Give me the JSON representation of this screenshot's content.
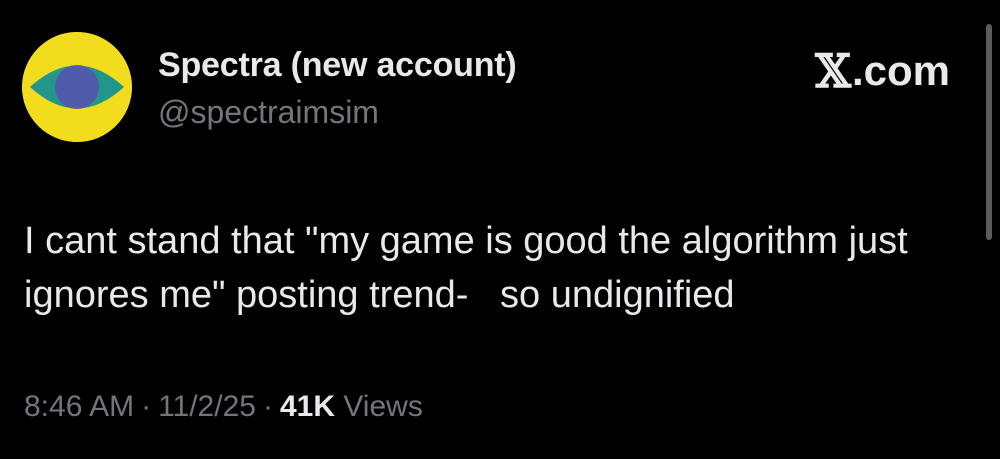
{
  "author": {
    "display_name": "Spectra (new account)",
    "handle": "@spectraimsim",
    "avatar": {
      "icon": "eye-icon",
      "background": "#f2dc1e",
      "iris_outer": "#23968c",
      "iris_inner": "#4f5aa8"
    }
  },
  "brand": {
    "x_glyph": "𝕏",
    "domain": ".com"
  },
  "tweet": {
    "text": "I cant stand that \"my game is good the algorithm just ignores me\" posting trend-   so undignified"
  },
  "meta": {
    "time": "8:46 AM",
    "separator": "·",
    "date": "11/2/25",
    "views_count": "41K",
    "views_label": "Views"
  },
  "colors": {
    "background": "#000000",
    "primary_text": "#e7e9ea",
    "secondary_text": "#71767b"
  }
}
